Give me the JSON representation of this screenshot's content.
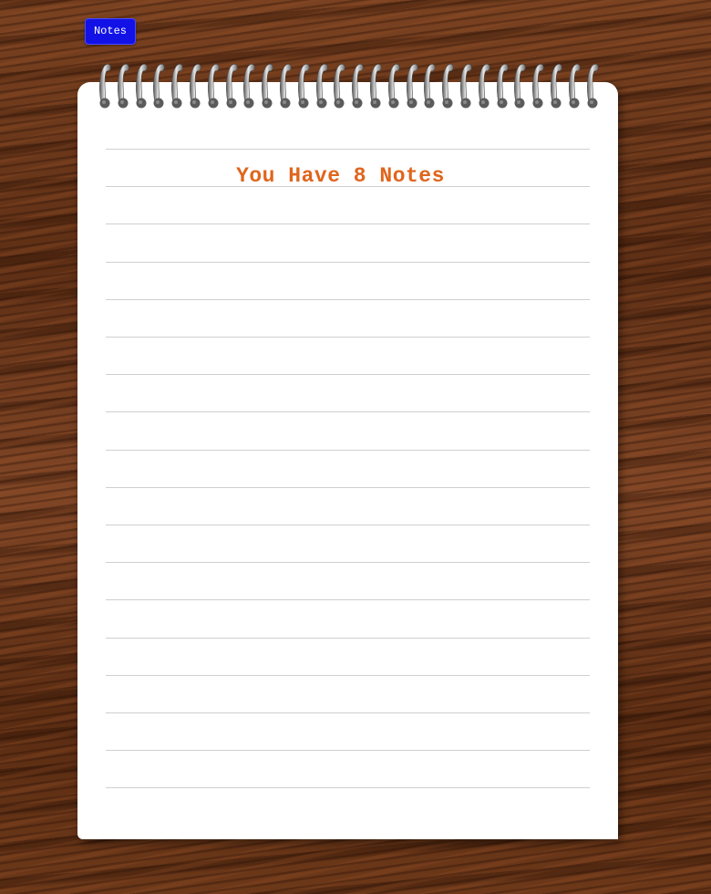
{
  "header": {
    "notes_button_label": "Notes"
  },
  "notepad": {
    "heading": "You Have 8 Notes",
    "note_count": 8,
    "line_count": 18,
    "spiral_ring_count": 28
  },
  "colors": {
    "heading": "#e0651c",
    "notes_button": "#1212e6",
    "paper": "#ffffff",
    "rule_line": "#cfcfcf"
  },
  "icons": {
    "binding": "spiral-binding-icon"
  }
}
